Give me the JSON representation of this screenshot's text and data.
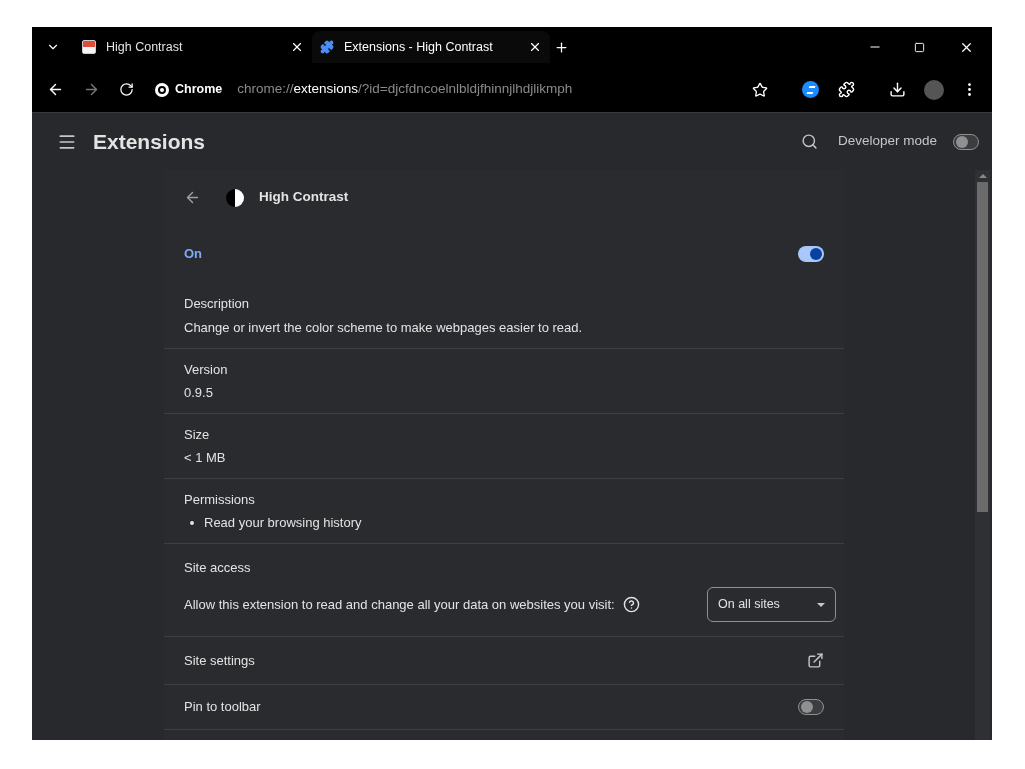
{
  "tabs": [
    {
      "title": "High Contrast",
      "kind": "page",
      "selected": false
    },
    {
      "title": "Extensions - High Contrast",
      "kind": "extension",
      "selected": true
    }
  ],
  "toolbar": {
    "site_label": "Chrome",
    "url_scheme": "chrome://",
    "url_host": "extensions",
    "url_rest": "/?id=djcfdncoelnlbldjfhinnjlhdjlikmph"
  },
  "header": {
    "title": "Extensions",
    "developer_mode": {
      "label": "Developer mode",
      "on": false
    }
  },
  "detail": {
    "name": "High Contrast",
    "enabled": {
      "label": "On",
      "on": true
    },
    "sections": [
      {
        "kind": "text",
        "heading": "Description",
        "value": "Change or invert the color scheme to make webpages easier to read."
      },
      {
        "kind": "text",
        "heading": "Version",
        "value": "0.9.5"
      },
      {
        "kind": "text",
        "heading": "Size",
        "value": "< 1 MB"
      },
      {
        "kind": "list",
        "heading": "Permissions",
        "items": [
          "Read your browsing history"
        ]
      },
      {
        "kind": "access",
        "heading": "Site access",
        "label": "Allow this extension to read and change all your data on websites you visit:",
        "dropdown": "On all sites"
      },
      {
        "kind": "link",
        "label": "Site settings"
      },
      {
        "kind": "toggle",
        "label": "Pin to toolbar",
        "on": false
      }
    ]
  }
}
